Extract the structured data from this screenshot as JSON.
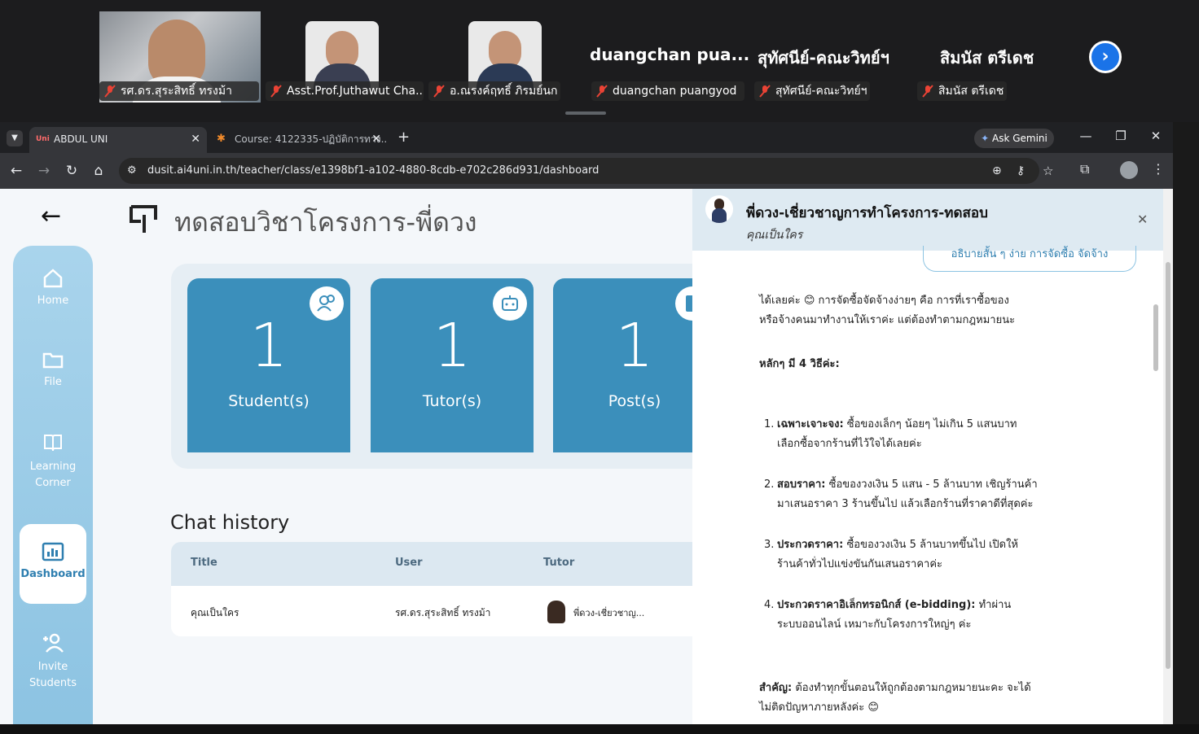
{
  "meeting": {
    "participants": [
      {
        "name": "รศ.ดร.สุระสิทธิ์ ทรงม้า"
      },
      {
        "name": "Asst.Prof.Juthawut Cha..."
      },
      {
        "name": "อ.ณรงค์ฤทธิ์ ภิรมย์นก"
      },
      {
        "name": "duangchan puangyod",
        "display": "duangchan pua..."
      },
      {
        "name": "สุทัศนีย์-คณะวิทย์ฯ",
        "display": "สุทัศนีย์-คณะวิทย์ฯ"
      },
      {
        "name": "สิมนัส ตรีเดช",
        "display": "สิมนัส ตรีเดช"
      }
    ]
  },
  "browser": {
    "tabs": [
      {
        "label": "ABDUL UNI",
        "favicon": "Uni"
      },
      {
        "label": "Course: 4122335-ปฏิบัติการทาง..."
      }
    ],
    "new_tab": "+",
    "ask_gemini": "Ask Gemini",
    "url": "dusit.ai4uni.in.th/teacher/class/e1398bf1-a102-4880-8cdb-e702c286d931/dashboard"
  },
  "app": {
    "page_title": "ทดสอบวิชาโครงการ-พี่ดวง",
    "nav": [
      {
        "label": "Home",
        "icon": "home-icon"
      },
      {
        "label": "File",
        "icon": "folder-icon"
      },
      {
        "label": "Learning Corner",
        "icon": "book-icon"
      },
      {
        "label": "Dashboard",
        "icon": "chart-icon",
        "active": true
      },
      {
        "label": "Invite Students",
        "icon": "add-user-icon"
      }
    ],
    "stats": [
      {
        "value": "1",
        "label": "Student(s)",
        "icon": "users-icon"
      },
      {
        "value": "1",
        "label": "Tutor(s)",
        "icon": "robot-icon"
      },
      {
        "value": "1",
        "label": "Post(s)",
        "icon": "post-icon"
      }
    ],
    "chat_history": {
      "title": "Chat history",
      "columns": [
        "Title",
        "User",
        "Tutor"
      ],
      "rows": [
        {
          "title": "คุณเป็นใคร",
          "user": "รศ.ดร.สุระสิทธิ์ ทรงม้า",
          "tutor": "พี่ดวง-เชี่ยวชาญ..."
        }
      ]
    }
  },
  "chat": {
    "name": "พี่ดวง-เชี่ยวชาญการทำโครงการ-ทดสอบ",
    "subtitle": "คุณเป็นใคร",
    "prev_question": "อธิบายสั้น ๆ ง่าย การจัดซื้อ จัดจ้าง",
    "intro_line1": "ได้เลยค่ะ 😊 การจัดซื้อจัดจ้างง่ายๆ คือ การที่เราซื้อของ",
    "intro_line2": "หรือจ้างคนมาทำงานให้เราค่ะ แต่ต้องทำตามกฎหมายนะ",
    "heading": "หลักๆ มี 4 วิธีค่ะ:",
    "items": [
      {
        "num": "1.",
        "bold": "เฉพาะเจาะจง:",
        "line1": " ซื้อของเล็กๆ น้อยๆ ไม่เกิน 5 แสนบาท",
        "line2": "เลือกซื้อจากร้านที่ไว้ใจได้เลยค่ะ"
      },
      {
        "num": "2.",
        "bold": "สอบราคา:",
        "line1": " ซื้อของวงเงิน 5 แสน - 5 ล้านบาท เชิญร้านค้า",
        "line2": "มาเสนอราคา 3 ร้านขึ้นไป แล้วเลือกร้านที่ราคาดีที่สุดค่ะ"
      },
      {
        "num": "3.",
        "bold": "ประกวดราคา:",
        "line1": " ซื้อของวงเงิน 5 ล้านบาทขึ้นไป เปิดให้",
        "line2": "ร้านค้าทั่วไปแข่งขันกันเสนอราคาค่ะ"
      },
      {
        "num": "4.",
        "bold": "ประกวดราคาอิเล็กทรอนิกส์ (e-bidding):",
        "line1": " ทำผ่าน",
        "line2": "ระบบออนไลน์ เหมาะกับโครงการใหญ่ๆ ค่ะ"
      }
    ],
    "important_bold": "สำคัญ:",
    "important_line1": " ต้องทำทุกขั้นตอนให้ถูกต้องตามกฎหมายนะคะ จะได้",
    "important_line2": "ไม่ติดปัญหาภายหลังค่ะ 😊"
  }
}
